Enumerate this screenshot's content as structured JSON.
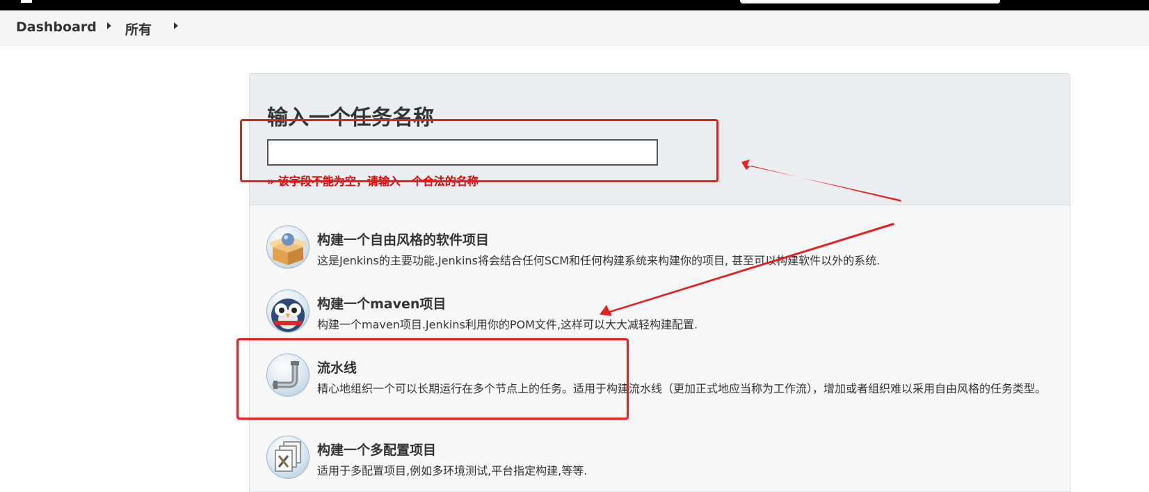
{
  "breadcrumb": {
    "items": [
      "Dashboard",
      "所有"
    ]
  },
  "name_section": {
    "title": "输入一个任务名称",
    "input_value": "",
    "error": "» 该字段不能为空，请输入一个合法的名称"
  },
  "job_types": [
    {
      "title": "构建一个自由风格的软件项目",
      "description": "这是Jenkins的主要功能.Jenkins将会结合任何SCM和任何构建系统来构建你的项目, 甚至可以构建软件以外的系统.",
      "icon": "freestyle-box-icon"
    },
    {
      "title": "构建一个maven项目",
      "description": "构建一个maven项目.Jenkins利用你的POM文件,这样可以大大减轻构建配置.",
      "icon": "maven-owl-icon"
    },
    {
      "title": "流水线",
      "description": "精心地组织一个可以长期运行在多个节点上的任务。适用于构建流水线（更加正式地应当称为工作流），增加或者组织难以采用自由风格的任务类型。",
      "icon": "pipeline-icon"
    },
    {
      "title": "构建一个多配置项目",
      "description": "适用于多配置项目,例如多环境测试,平台指定构建,等等.",
      "icon": "multi-config-icon"
    }
  ],
  "colors": {
    "annotation": "#ea1d1d",
    "error": "#e60000",
    "header_bg": "#000000"
  }
}
